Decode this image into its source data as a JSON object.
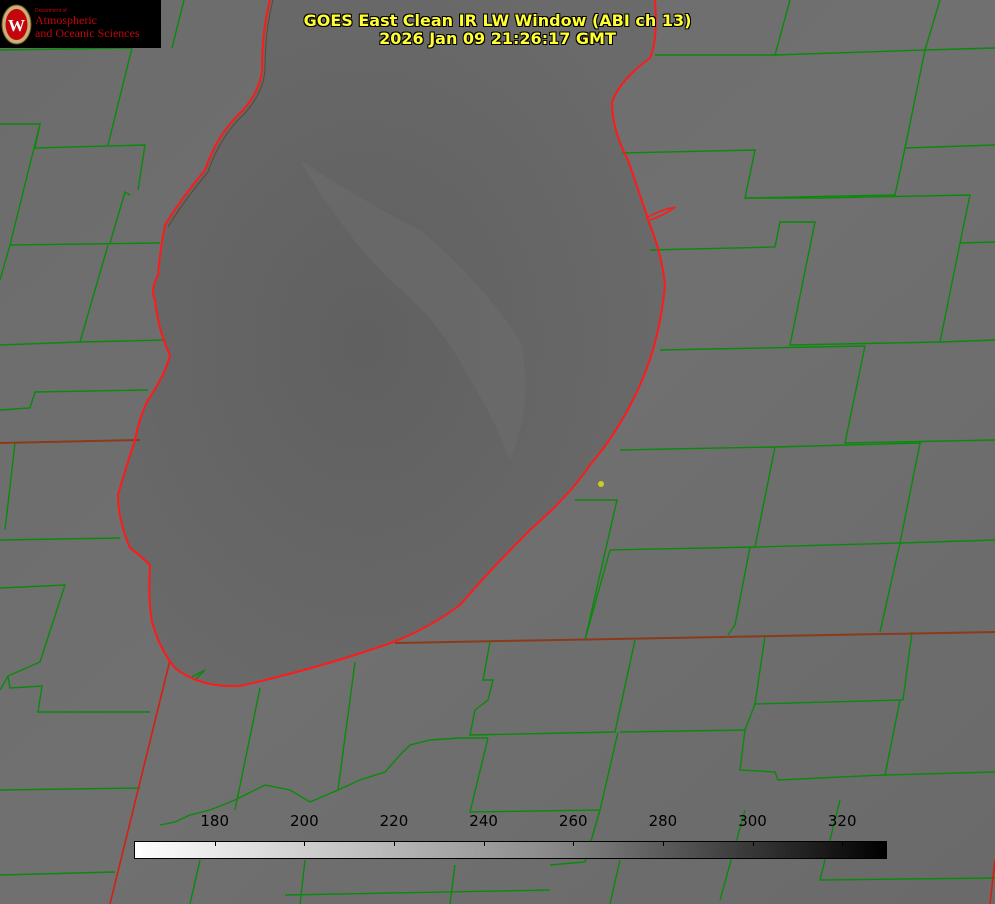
{
  "title": {
    "line1": "GOES East Clean IR LW Window (ABI ch 13)",
    "line2": "2026 Jan 09 21:26:17 GMT"
  },
  "logo": {
    "department": "Department of",
    "line1": "Atmospheric",
    "line2": "and Oceanic Sciences",
    "seal_letter": "W"
  },
  "colorbar": {
    "min": 162,
    "max": 330,
    "ticks": [
      "180",
      "200",
      "220",
      "240",
      "260",
      "280",
      "300",
      "320"
    ],
    "tick_values": [
      180,
      200,
      220,
      240,
      260,
      280,
      300,
      320
    ]
  },
  "colors": {
    "background_gray": "#6f6f6f",
    "lake_gray": "#656565",
    "county_lines": "#0a8a0a",
    "shoreline": "#ff1a1a",
    "title_text": "#ffff33",
    "logo_red": "#c5050c"
  }
}
